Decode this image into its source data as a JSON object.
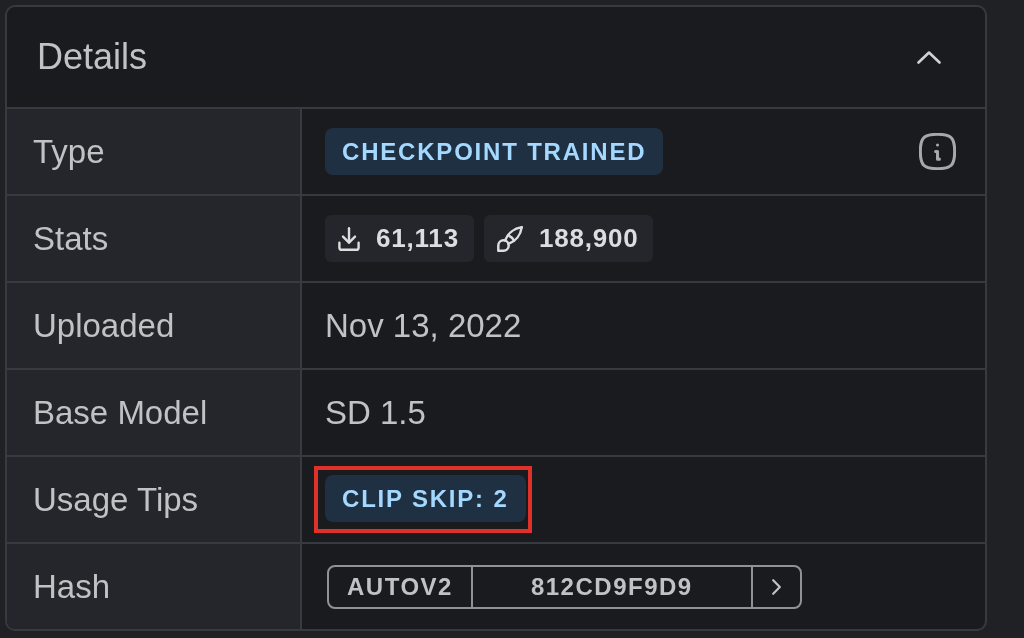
{
  "panel": {
    "title": "Details",
    "expanded": true
  },
  "rows": [
    {
      "kind": "badge",
      "label": "Type",
      "badge": "CHECKPOINT TRAINED",
      "info_button": true,
      "highlighted": false
    },
    {
      "kind": "stats",
      "label": "Stats",
      "stats": [
        {
          "kind": "download",
          "count": "61,113"
        },
        {
          "kind": "brush",
          "count": "188,900"
        }
      ]
    },
    {
      "kind": "text",
      "label": "Uploaded",
      "value": "Nov 13, 2022"
    },
    {
      "kind": "text",
      "label": "Base Model",
      "value": "SD 1.5"
    },
    {
      "kind": "badge",
      "label": "Usage Tips",
      "badge": "CLIP SKIP: 2",
      "info_button": false,
      "highlighted": true
    },
    {
      "kind": "hash",
      "label": "Hash",
      "hash_type": "AUTOV2",
      "hash": "812CD9F9D9"
    }
  ]
}
